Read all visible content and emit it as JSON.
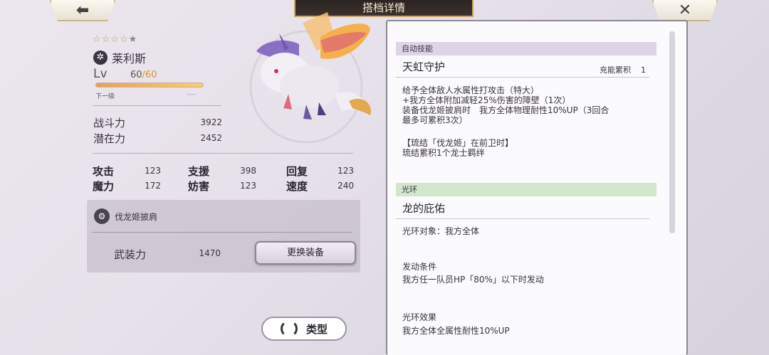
{
  "nav": {
    "back_icon": "back-arrow-icon",
    "close_icon": "close-icon",
    "title": "搭档详情"
  },
  "character": {
    "stars_filled": "☆☆☆☆",
    "stars_dim": "★",
    "element_icon": "element-icon",
    "name": "莱利斯",
    "level_label": "Lv",
    "level": "60",
    "level_sep": "/",
    "level_max": "60",
    "next_label": "下一级",
    "next_value": "----",
    "level_progress": 1.0
  },
  "power": [
    {
      "label": "战斗力",
      "value": "3922"
    },
    {
      "label": "潜在力",
      "value": "2452"
    }
  ],
  "attributes": [
    {
      "label": "攻击",
      "value": "123"
    },
    {
      "label": "支援",
      "value": "398"
    },
    {
      "label": "回复",
      "value": "123"
    },
    {
      "label": "魔力",
      "value": "172"
    },
    {
      "label": "妨害",
      "value": "123"
    },
    {
      "label": "速度",
      "value": "240"
    }
  ],
  "equipment": {
    "icon": "equipment-icon",
    "name": "伐龙姬披肩",
    "armament_label": "武装力",
    "armament_value": "1470",
    "change_button": "更换装备"
  },
  "type_button": "类型",
  "skills": {
    "auto": {
      "category": "自动技能",
      "name": "天虹守护",
      "energy_label": "充能累积",
      "energy_value": "1",
      "description": "给予全体敌人水属性打攻击（特大）\n+我方全体附加减轻25%伤害的障壁（1次）\n装备伐龙姬披肩时　我方全体物理耐性10%UP（3回合\n最多可累积3次）",
      "bond": "【琉结「伐龙姬」在前卫时】\n琉结累积1个龙士羁绊"
    },
    "aura": {
      "category": "光环",
      "name": "龙的庇佑",
      "target": "光环对象：我方全体",
      "condition_label": "发动条件",
      "condition": "我方任一队员HP「80%」以下时发动",
      "effect_label": "光环效果",
      "effect": "我方全体全属性耐性10%UP"
    }
  }
}
